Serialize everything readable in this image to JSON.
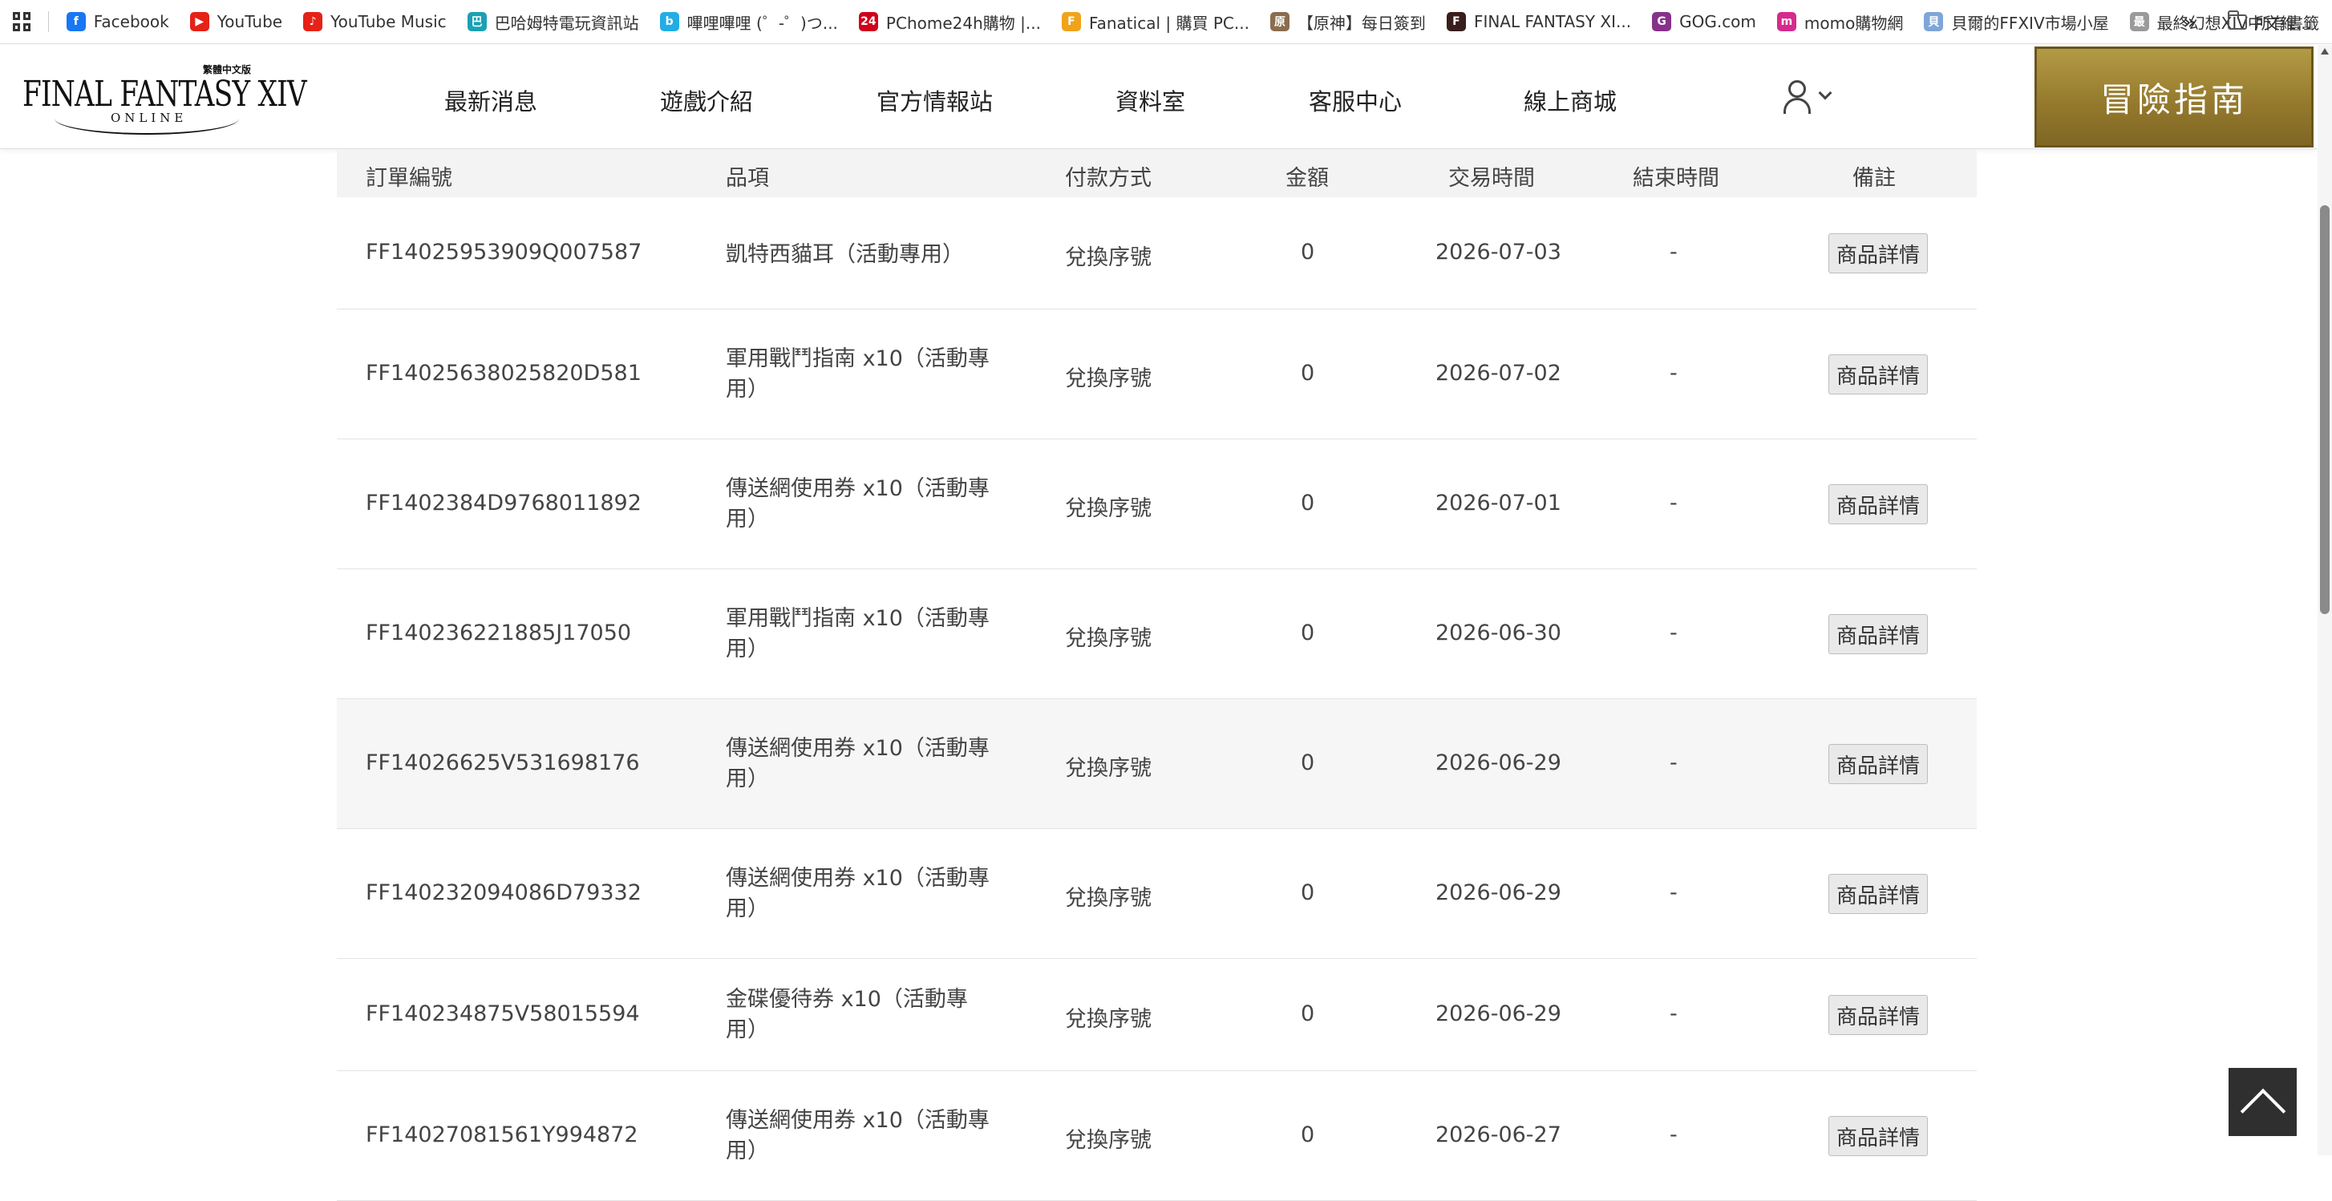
{
  "bookmarks": [
    {
      "label": "Facebook",
      "icon": "facebook-icon",
      "color": "#1877f2",
      "glyph": "f"
    },
    {
      "label": "YouTube",
      "icon": "youtube-icon",
      "color": "#e62117",
      "glyph": "▶"
    },
    {
      "label": "YouTube Music",
      "icon": "youtube-music-icon",
      "color": "#e62117",
      "glyph": "♪"
    },
    {
      "label": "巴哈姆特電玩資訊站",
      "icon": "bahamut-icon",
      "color": "#19a1b4",
      "glyph": "巴"
    },
    {
      "label": "嗶哩嗶哩 (゜-゜)つ...",
      "icon": "bilibili-icon",
      "color": "#23ade5",
      "glyph": "b"
    },
    {
      "label": "PChome24h購物 |...",
      "icon": "pchome-icon",
      "color": "#d0021b",
      "glyph": "24"
    },
    {
      "label": "Fanatical | 購買 PC...",
      "icon": "fanatical-icon",
      "color": "#f0a31b",
      "glyph": "F"
    },
    {
      "label": "【原神】每日簽到",
      "icon": "genshin-icon",
      "color": "#8a6d4e",
      "glyph": "原"
    },
    {
      "label": "FINAL FANTASY XI...",
      "icon": "ffxi-icon",
      "color": "#3a1d1d",
      "glyph": "F"
    },
    {
      "label": "GOG.com",
      "icon": "gog-icon",
      "color": "#86328a",
      "glyph": "G"
    },
    {
      "label": "momo購物網",
      "icon": "momo-icon",
      "color": "#d62a8c",
      "glyph": "m"
    },
    {
      "label": "貝爾的FFXIV市場小屋",
      "icon": "market-icon",
      "color": "#7ea6d8",
      "glyph": "貝"
    },
    {
      "label": "最終幻想XIV中文維...",
      "icon": "wiki-icon",
      "color": "#9a9a9a",
      "glyph": "最"
    }
  ],
  "bookmarks_folder": "所有書籤",
  "header": {
    "logo_title": "FINAL FANTASY XIV",
    "logo_sub": "ONLINE",
    "logo_tag": "繁體中文版",
    "nav": [
      "最新消息",
      "遊戲介紹",
      "官方情報站",
      "資料室",
      "客服中心",
      "線上商城"
    ],
    "guide_button": "冒險指南"
  },
  "table": {
    "headers": [
      "訂單編號",
      "品項",
      "付款方式",
      "金額",
      "交易時間",
      "結束時間",
      "備註"
    ],
    "detail_label": "商品詳情",
    "rows": [
      {
        "order_id": "FF14025953909Q007587",
        "item": "凱特西貓耳（活動專用）",
        "payment": "兌換序號",
        "amount": "0",
        "time": "2026-07-03",
        "end": "-"
      },
      {
        "order_id": "FF14025638025820D581",
        "item": "軍用戰鬥指南 x10（活動專用）",
        "payment": "兌換序號",
        "amount": "0",
        "time": "2026-07-02",
        "end": "-"
      },
      {
        "order_id": "FF1402384D9768011892",
        "item": "傳送網使用券 x10（活動專用）",
        "payment": "兌換序號",
        "amount": "0",
        "time": "2026-07-01",
        "end": "-"
      },
      {
        "order_id": "FF140236221885J17050",
        "item": "軍用戰鬥指南 x10（活動專用）",
        "payment": "兌換序號",
        "amount": "0",
        "time": "2026-06-30",
        "end": "-"
      },
      {
        "order_id": "FF14026625V531698176",
        "item": "傳送網使用券 x10（活動專用）",
        "payment": "兌換序號",
        "amount": "0",
        "time": "2026-06-29",
        "end": "-"
      },
      {
        "order_id": "FF140232094086D79332",
        "item": "傳送網使用券 x10（活動專用）",
        "payment": "兌換序號",
        "amount": "0",
        "time": "2026-06-29",
        "end": "-"
      },
      {
        "order_id": "FF140234875V58015594",
        "item": "金碟優待券 x10（活動專用）",
        "payment": "兌換序號",
        "amount": "0",
        "time": "2026-06-29",
        "end": "-"
      },
      {
        "order_id": "FF14027081561Y994872",
        "item": "傳送網使用券 x10（活動專用）",
        "payment": "兌換序號",
        "amount": "0",
        "time": "2026-06-27",
        "end": "-"
      }
    ]
  }
}
